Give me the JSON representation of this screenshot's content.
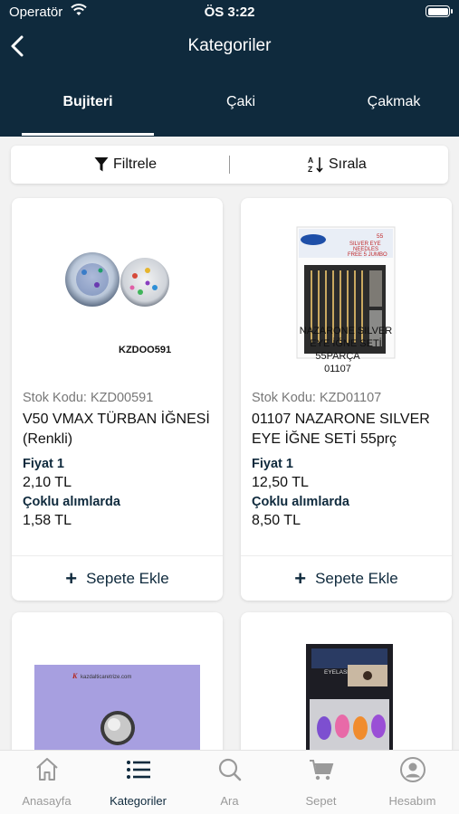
{
  "status": {
    "carrier": "Operatör",
    "time": "ÖS 3:22"
  },
  "header": {
    "title": "Kategoriler"
  },
  "tabs": [
    {
      "label": "Bujiteri",
      "active": true
    },
    {
      "label": "Çaki",
      "active": false
    },
    {
      "label": "Çakmak",
      "active": false
    }
  ],
  "toolbar": {
    "filter_label": "Filtrele",
    "sort_label": "Sırala"
  },
  "products": [
    {
      "stock_code": "Stok Kodu: KZD00591",
      "name": "V50   VMAX TÜRBAN İĞNESİ (Renkli)",
      "price_label": "Fiyat 1",
      "price": "2,10 TL",
      "bulk_label": "Çoklu alımlarda",
      "bulk_price": "1,58 TL",
      "cta": "Sepete Ekle",
      "image_caption": "KZDOO591"
    },
    {
      "stock_code": "Stok Kodu: KZD01107",
      "name": "01107   NAZARONE SILVER EYE İĞNE SETİ 55prç",
      "price_label": "Fiyat 1",
      "price": "12,50 TL",
      "bulk_label": "Çoklu alımlarda",
      "bulk_price": "8,50 TL",
      "cta": "Sepete Ekle",
      "image_caption_lines": [
        "NAZARONE SILVER",
        "EYE İĞNE SETİ",
        "55PARÇA",
        "01107"
      ],
      "package_text": [
        "55",
        "SILVER EYE",
        "NEEDLES",
        "FREE 5 JUMBO"
      ]
    },
    {
      "image_caption": "kazdalticaretrize.com"
    },
    {
      "image_caption": "EYELASH"
    }
  ],
  "nav": [
    {
      "label": "Anasayfa",
      "icon": "home-icon",
      "active": false
    },
    {
      "label": "Kategoriler",
      "icon": "list-icon",
      "active": true
    },
    {
      "label": "Ara",
      "icon": "search-icon",
      "active": false
    },
    {
      "label": "Sepet",
      "icon": "cart-icon",
      "active": false
    },
    {
      "label": "Hesabım",
      "icon": "account-icon",
      "active": false
    }
  ],
  "colors": {
    "header_bg": "#0f2a3d",
    "accent": "#0f2a3d",
    "inactive": "#9a9a9a"
  }
}
